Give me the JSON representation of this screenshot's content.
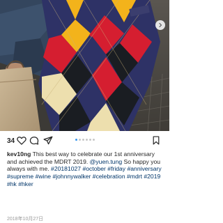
{
  "post": {
    "likes_count": "34",
    "username": "kev10ng",
    "caption_text": "This best way to celebrate our 1st anniversary and achieved the MDRT 2019.",
    "mention": "@yuen.tung",
    "caption_after_mention": "So happy you always with me.",
    "hashtags": [
      "#20181027",
      "#october",
      "#friday",
      "#anniversary",
      "#supreme",
      "#wine",
      "#johnnywalker",
      "#celebration",
      "#mdrt",
      "#2019",
      "#hk",
      "#hker"
    ],
    "date": "2018年10月27日",
    "carousel": {
      "total": 6,
      "active_index": 0
    }
  },
  "icons": {
    "like": "heart-icon",
    "comment": "speech-bubble-icon",
    "share": "paper-plane-icon",
    "save": "bookmark-icon",
    "next": "chevron-right-icon"
  },
  "colors": {
    "hashtag": "#003569",
    "active_dot": "#3897f0",
    "argyle_navy": "#2e3266",
    "argyle_red": "#d51e30",
    "argyle_yellow": "#f3b31b",
    "argyle_black": "#1a1d22",
    "argyle_cream": "#eddfae"
  }
}
